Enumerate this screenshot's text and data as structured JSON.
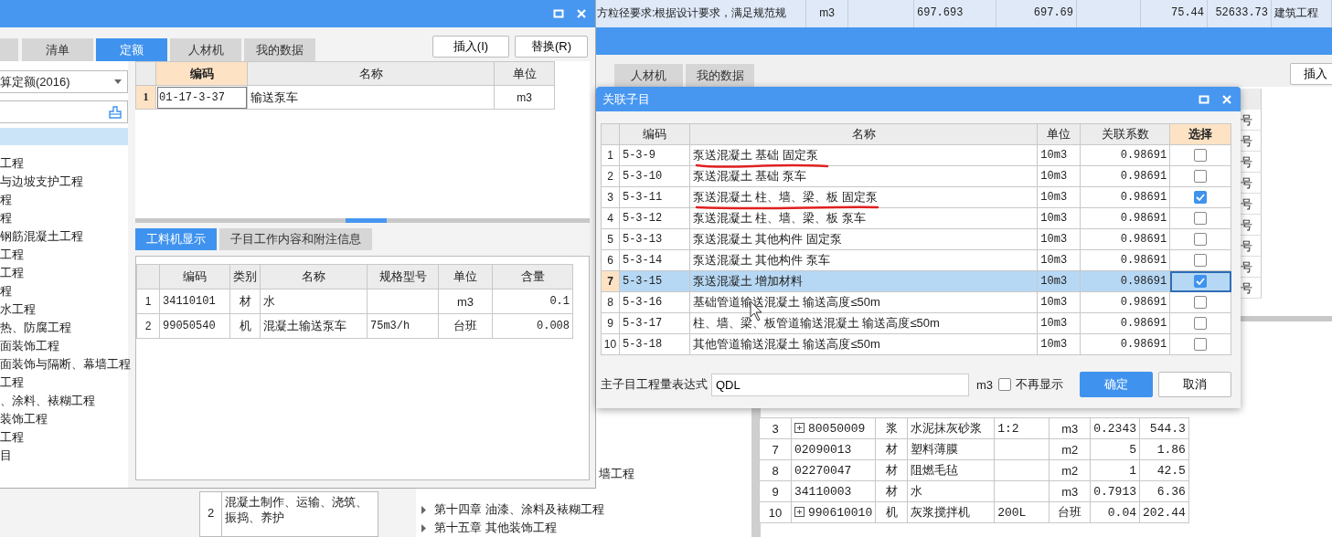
{
  "background": {
    "top_row": [
      "方粒径要求:根据设计要求，满足规范规",
      "m3",
      "697.693",
      "697.69",
      "75.44",
      "52633.73",
      "建筑工程"
    ],
    "tabs": [
      {
        "label": "人材机",
        "selected": false
      },
      {
        "label": "我的数据",
        "selected": false
      }
    ],
    "insert_button": "插入",
    "side_cells": [
      "号",
      "号",
      "号",
      "号",
      "号",
      "号",
      "号",
      "号",
      "号"
    ],
    "tree_text": "墙工程",
    "content_cell": {
      "index": "2",
      "text": "混凝土制作、运输、浇筑、振捣、养护"
    },
    "chapters": [
      {
        "label": "第十四章 油漆、涂料及裱糊工程",
        "expanded": false
      },
      {
        "label": "第十五章 其他装饰工程",
        "expanded": false
      }
    ],
    "resource_rows": [
      {
        "expandable": true,
        "cells": [
          "3",
          "80050009",
          "浆",
          "水泥抹灰砂浆",
          "1:2",
          "m3",
          "0.2343",
          "544.3"
        ]
      },
      {
        "expandable": false,
        "cells": [
          "7",
          "02090013",
          "材",
          "塑料薄膜",
          "",
          "m2",
          "5",
          "1.86"
        ]
      },
      {
        "expandable": false,
        "cells": [
          "8",
          "02270047",
          "材",
          "阻燃毛毡",
          "",
          "m2",
          "1",
          "42.5"
        ]
      },
      {
        "expandable": false,
        "cells": [
          "9",
          "34110003",
          "材",
          "水",
          "",
          "m3",
          "0.7913",
          "6.36"
        ]
      },
      {
        "expandable": true,
        "cells": [
          "10",
          "990610010",
          "机",
          "灰浆搅拌机",
          "200L",
          "台班",
          "0.04",
          "202.44"
        ]
      }
    ]
  },
  "quota_window": {
    "tabs": [
      {
        "label": "清单",
        "selected": false
      },
      {
        "label": "定额",
        "selected": true
      },
      {
        "label": "人材机",
        "selected": false
      },
      {
        "label": "我的数据",
        "selected": false
      }
    ],
    "buttons": [
      "插入(I)",
      "替换(R)"
    ],
    "library": "算定额(2016)",
    "tree": [
      {
        "label": "工程"
      },
      {
        "label": "与边坡支护工程"
      },
      {
        "label": "程"
      },
      {
        "label": "程"
      },
      {
        "label": "钢筋混凝土工程"
      },
      {
        "label": "工程"
      },
      {
        "label": "工程"
      },
      {
        "label": "程"
      },
      {
        "label": "水工程"
      },
      {
        "label": "热、防腐工程"
      },
      {
        "label": "面装饰工程"
      },
      {
        "label": "面装饰与隔断、幕墙工程"
      },
      {
        "label": "工程"
      },
      {
        "label": "、涂料、裱糊工程"
      },
      {
        "label": "装饰工程"
      },
      {
        "label": "工程"
      },
      {
        "label": "目"
      }
    ],
    "quota_table": {
      "columns": [
        "编码",
        "名称",
        "单位"
      ],
      "rows": [
        {
          "index": "1",
          "cells": [
            "01-17-3-37",
            "输送泵车",
            "m3"
          ]
        }
      ]
    },
    "detail_tabs": [
      {
        "label": "工料机显示",
        "selected": true
      },
      {
        "label": "子目工作内容和附注信息",
        "selected": false
      }
    ],
    "resource_table": {
      "columns": [
        "编码",
        "类别",
        "名称",
        "规格型号",
        "单位",
        "含量"
      ],
      "rows": [
        {
          "index": "1",
          "cells": [
            "34110101",
            "材",
            "水",
            "",
            "m3",
            "0.1"
          ]
        },
        {
          "index": "2",
          "cells": [
            "99050540",
            "机",
            "混凝土输送泵车",
            "75m3/h",
            "台班",
            "0.008"
          ]
        }
      ]
    }
  },
  "link_dialog": {
    "title": "关联子目",
    "columns": [
      "编码",
      "名称",
      "单位",
      "关联系数",
      "选择"
    ],
    "rows": [
      {
        "index": "1",
        "code": "5-3-9",
        "name": "泵送混凝土 基础 固定泵",
        "unit": "10m3",
        "factor": "0.98691",
        "checked": false,
        "selected": false
      },
      {
        "index": "2",
        "code": "5-3-10",
        "name": "泵送混凝土 基础 泵车",
        "unit": "10m3",
        "factor": "0.98691",
        "checked": false,
        "selected": false
      },
      {
        "index": "3",
        "code": "5-3-11",
        "name": "泵送混凝土 柱、墙、梁、板 固定泵",
        "unit": "10m3",
        "factor": "0.98691",
        "checked": true,
        "selected": false
      },
      {
        "index": "4",
        "code": "5-3-12",
        "name": "泵送混凝土 柱、墙、梁、板 泵车",
        "unit": "10m3",
        "factor": "0.98691",
        "checked": false,
        "selected": false
      },
      {
        "index": "5",
        "code": "5-3-13",
        "name": "泵送混凝土 其他构件 固定泵",
        "unit": "10m3",
        "factor": "0.98691",
        "checked": false,
        "selected": false
      },
      {
        "index": "6",
        "code": "5-3-14",
        "name": "泵送混凝土 其他构件 泵车",
        "unit": "10m3",
        "factor": "0.98691",
        "checked": false,
        "selected": false
      },
      {
        "index": "7",
        "code": "5-3-15",
        "name": "泵送混凝土 增加材料",
        "unit": "10m3",
        "factor": "0.98691",
        "checked": true,
        "selected": true
      },
      {
        "index": "8",
        "code": "5-3-16",
        "name": "基础管道输送混凝土 输送高度≤50m",
        "unit": "10m3",
        "factor": "0.98691",
        "checked": false,
        "selected": false
      },
      {
        "index": "9",
        "code": "5-3-17",
        "name": "柱、墙、梁、板管道输送混凝土 输送高度≤50m",
        "unit": "10m3",
        "factor": "0.98691",
        "checked": false,
        "selected": false
      },
      {
        "index": "10",
        "code": "5-3-18",
        "name": "其他管道输送混凝土 输送高度≤50m",
        "unit": "10m3",
        "factor": "0.98691",
        "checked": false,
        "selected": false
      }
    ],
    "expression_label": "主子目工程量表达式",
    "expression": "QDL",
    "expression_unit": "m3",
    "dont_show": {
      "label": "不再显示",
      "checked": false
    },
    "buttons": [
      {
        "label": "确定",
        "kind": "primary"
      },
      {
        "label": "取消",
        "kind": "default"
      }
    ]
  }
}
